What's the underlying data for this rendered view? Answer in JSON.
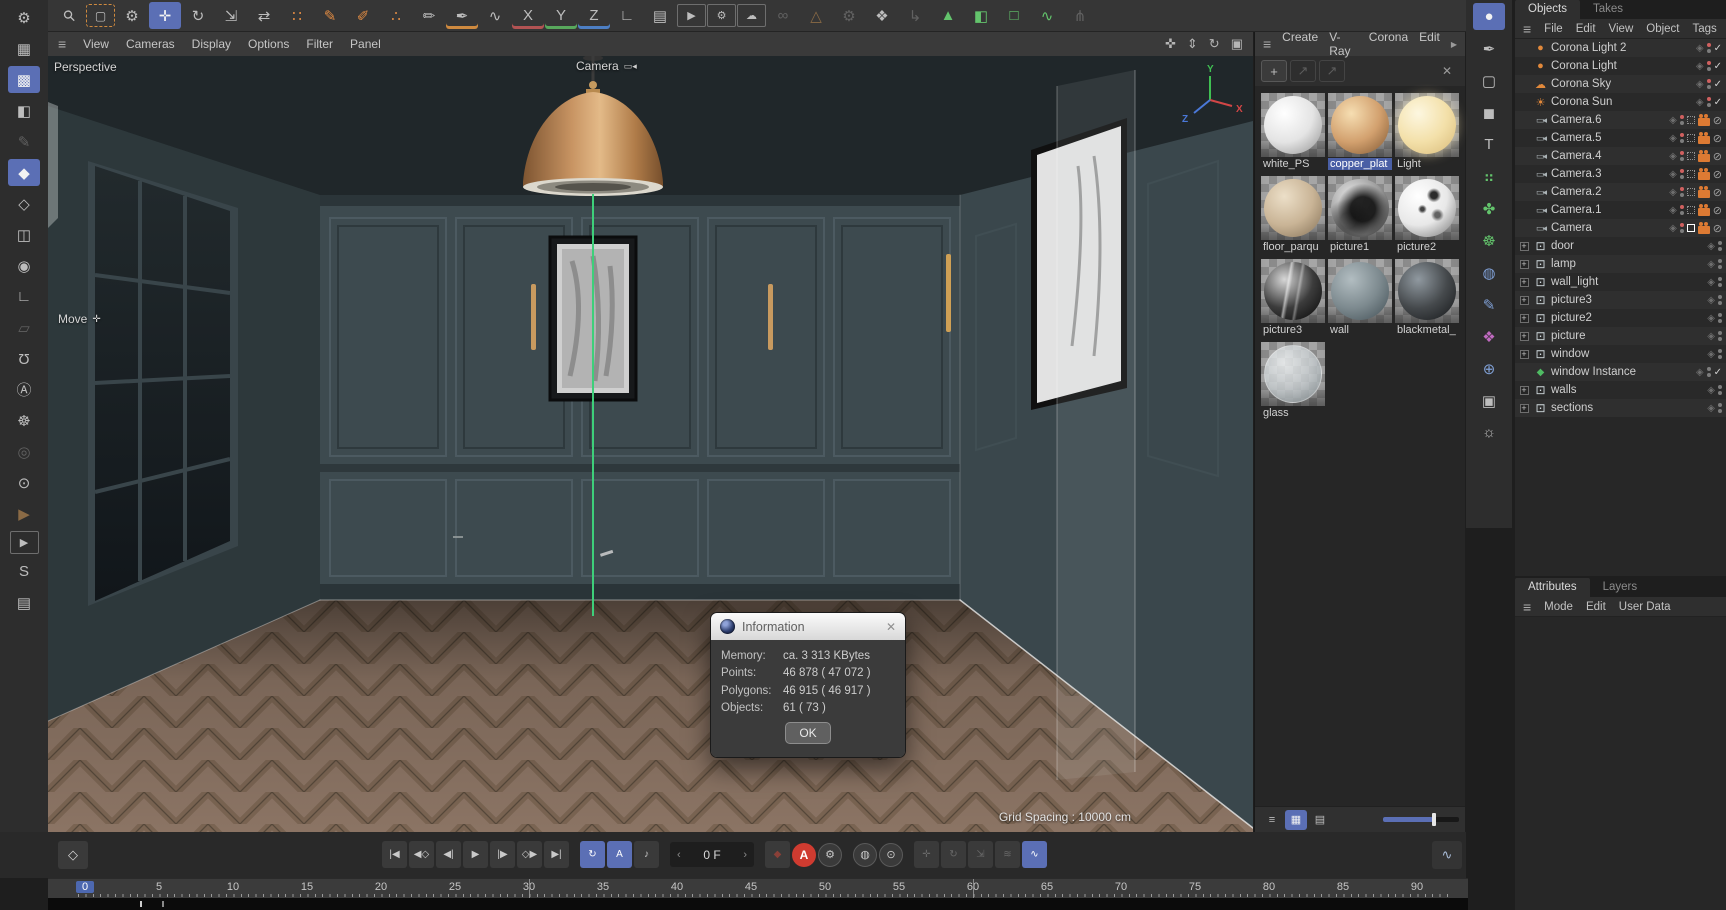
{
  "colors": {
    "accent_blue": "#5b6fb5",
    "accent_orange": "#e08b43",
    "corona_green": "#63c46c",
    "autokey_red": "#cf3b30",
    "playhead_blue": "#4d68b0",
    "material_selected": "#4a5fa5",
    "wall": "#3d4a4f",
    "floor": "#8b7464",
    "gizmo_x": "#d24646",
    "gizmo_y": "#3fbf52",
    "gizmo_z": "#4a78d8"
  },
  "icons": {
    "burger": "≡",
    "close": "✕",
    "check": "✓",
    "prohibit": "⊘",
    "layers": "◈",
    "expand": "+"
  },
  "left_toolbar": {
    "items": [
      {
        "n": "preferences-icon",
        "g": "⚙"
      },
      {
        "n": "workplane-icon",
        "g": "▦"
      },
      {
        "n": "lock-workplane-icon",
        "g": "▩",
        "c": "sel"
      },
      {
        "n": "model-mode-icon",
        "g": "◧"
      },
      {
        "n": "texture-mode-icon",
        "g": "✎",
        "c": "dim"
      },
      {
        "n": "object-mode-icon",
        "g": "◆",
        "c": "sel"
      },
      {
        "n": "polygon-mode-icon",
        "g": "◇"
      },
      {
        "n": "edge-mode-icon",
        "g": "◫"
      },
      {
        "n": "point-mode-icon",
        "g": "◉"
      },
      {
        "n": "axis-mode-icon",
        "g": "∟"
      },
      {
        "n": "workplane-mode-icon",
        "g": "▱",
        "c": "dim"
      },
      {
        "n": "snap-icon",
        "g": "Ω",
        "c": "flip"
      },
      {
        "n": "quantize-icon",
        "g": "Ⓐ"
      },
      {
        "n": "modes-gear-icon",
        "g": "☸"
      },
      {
        "n": "target-icon",
        "g": "◎",
        "c": "dim"
      },
      {
        "n": "solo-icon",
        "g": "⊙"
      },
      {
        "n": "ir-region-icon",
        "g": "▶",
        "c": "dim-orange"
      },
      {
        "n": "interactive-render-icon",
        "g": "▶",
        "c": "boxed"
      },
      {
        "n": "substance-icon",
        "g": "S"
      },
      {
        "n": "asset-browser-icon",
        "g": "▤"
      }
    ]
  },
  "top_toolbar": {
    "items": [
      {
        "n": "search-icon",
        "g": "⚲",
        "c": "rot45"
      },
      {
        "n": "live-selection-icon",
        "g": "▢",
        "c": "orange-dash"
      },
      {
        "n": "tweak-icon",
        "g": "⚙"
      },
      {
        "n": "move-icon",
        "g": "✛",
        "c": "sel"
      },
      {
        "n": "rotate-icon",
        "g": "↻"
      },
      {
        "n": "scale-icon",
        "g": "⇲"
      },
      {
        "n": "transform-tool-icon",
        "g": "⇄"
      },
      {
        "n": "point-transform-icon",
        "g": "∷",
        "c": "orange"
      },
      {
        "n": "spline-pen-icon",
        "g": "✎",
        "c": "orange"
      },
      {
        "n": "polygon-pen-icon",
        "g": "✐",
        "c": "orange"
      },
      {
        "n": "point-weld-icon",
        "g": "∴",
        "c": "orange"
      },
      {
        "n": "brush-icon",
        "g": "✏"
      },
      {
        "n": "pen-tool-icon",
        "g": "✒",
        "c": "u-orange"
      },
      {
        "n": "sculpt-icon",
        "g": "∿"
      },
      {
        "n": "x-axis-icon",
        "g": "X",
        "c": "u-red"
      },
      {
        "n": "y-axis-icon",
        "g": "Y",
        "c": "u-green"
      },
      {
        "n": "z-axis-icon",
        "g": "Z",
        "c": "u-blue"
      },
      {
        "n": "coord-system-icon",
        "g": "∟"
      },
      {
        "n": "render-view-icon",
        "g": "▤"
      },
      {
        "n": "render-picture-viewer-icon",
        "g": "▶",
        "c": "boxed"
      },
      {
        "n": "render-settings-icon",
        "g": "⚙",
        "c": "boxed"
      },
      {
        "n": "render-queue-icon",
        "g": "☁",
        "c": "boxed"
      },
      {
        "n": "link-icon",
        "g": "∞",
        "c": "dim"
      },
      {
        "n": "triangulate-icon",
        "g": "△",
        "c": "dim-orange"
      },
      {
        "n": "gear-icon",
        "g": "⚙",
        "c": "dim"
      },
      {
        "n": "center-axis-icon",
        "g": "❖"
      },
      {
        "n": "axis-transfer-icon",
        "g": "↳",
        "c": "dim"
      },
      {
        "n": "corona-proxy-icon",
        "g": "▲",
        "c": "green"
      },
      {
        "n": "corona-scatter-icon",
        "g": "◧",
        "c": "green"
      },
      {
        "n": "corona-volume-icon",
        "g": "□",
        "c": "green"
      },
      {
        "n": "corona-slicer-icon",
        "g": "∿",
        "c": "green"
      },
      {
        "n": "joint-tool-icon",
        "g": "⋔",
        "c": "dim"
      }
    ]
  },
  "right_strip": {
    "items": [
      {
        "n": "material-ball-icon",
        "g": "●",
        "c": "sel"
      },
      {
        "n": "paint-tool-icon",
        "g": "✒"
      },
      {
        "n": "plane-icon",
        "g": "▢"
      },
      {
        "n": "cube-icon",
        "g": "◼"
      },
      {
        "n": "text-tool-icon",
        "g": "T"
      },
      {
        "n": "cluster-icon",
        "g": "⠶",
        "c": "green"
      },
      {
        "n": "field-icon",
        "g": "✤",
        "c": "green"
      },
      {
        "n": "dynamics-icon",
        "g": "☸",
        "c": "green"
      },
      {
        "n": "sphere-icon",
        "g": "◍",
        "c": "blue"
      },
      {
        "n": "spline-draw-icon",
        "g": "✎",
        "c": "blue"
      },
      {
        "n": "mograph-icon",
        "g": "❖",
        "c": "magenta"
      },
      {
        "n": "globe-icon",
        "g": "⊕",
        "c": "blue"
      },
      {
        "n": "camera-add-icon",
        "g": "▣"
      },
      {
        "n": "light-icon",
        "g": "☼"
      }
    ]
  },
  "viewport": {
    "menu": [
      "View",
      "Cameras",
      "Display",
      "Options",
      "Filter",
      "Panel"
    ],
    "right_icons": [
      {
        "n": "pan-icon",
        "g": "✜"
      },
      {
        "n": "dolly-icon",
        "g": "⇕"
      },
      {
        "n": "orbit-icon",
        "g": "↻"
      },
      {
        "n": "viewport-toggle-icon",
        "g": "▣"
      }
    ],
    "hud": {
      "view_label": "Perspective",
      "camera_label": "Camera",
      "camera_icon": "▭◂",
      "tool_label": "Move",
      "tool_icon": "✛",
      "grid_spacing": "Grid Spacing : 10000 cm"
    }
  },
  "dialog": {
    "title": "Information",
    "rows": [
      {
        "label": "Memory:",
        "value": "ca. 3 313 KBytes"
      },
      {
        "label": "Points:",
        "value": "46 878 ( 47 072 )"
      },
      {
        "label": "Polygons:",
        "value": "46 915 ( 46 917 )"
      },
      {
        "label": "Objects:",
        "value": "61 ( 73 )"
      }
    ],
    "ok_label": "OK"
  },
  "materials": {
    "menu": [
      "Create",
      "V-Ray",
      "Corona",
      "Edit"
    ],
    "overflow_icon": "▶",
    "tools": [
      {
        "n": "add-material-button",
        "g": "+"
      },
      {
        "n": "promote-arrow-icon",
        "g": "↗",
        "c": "dim"
      },
      {
        "n": "promote-arrow2-icon",
        "g": "↗",
        "c": "dim"
      }
    ],
    "delete_icon": "✕",
    "items": [
      {
        "name": "white_PS",
        "hi": "#ffffff",
        "base": "#e4e4e4",
        "lo": "#8f8f8f"
      },
      {
        "name": "copper_plat",
        "hi": "#f6deb2",
        "base": "#d2a06e",
        "lo": "#7d5530",
        "selCls": "sel"
      },
      {
        "name": "Light",
        "hi": "#fdf7e0",
        "base": "#f3e0a9",
        "lo": "#d8ba78",
        "fx": "glow"
      },
      {
        "name": "floor_parqu",
        "hi": "#ecdfc8",
        "base": "#c9b496",
        "lo": "#826f55"
      },
      {
        "name": "picture1",
        "hi": "#e6e6e6",
        "base": "#9b9b9b",
        "lo": "#1f1f1f",
        "fx": "marble"
      },
      {
        "name": "picture2",
        "hi": "#ffffff",
        "base": "#e8e8e8",
        "lo": "#6f6f6f",
        "fx": "splat"
      },
      {
        "name": "picture3",
        "hi": "#d6d6d6",
        "base": "#3c3c3c",
        "lo": "#050505",
        "fx": "streak"
      },
      {
        "name": "wall",
        "hi": "#b2bdc1",
        "base": "#7d8a8f",
        "lo": "#404d53"
      },
      {
        "name": "blackmetal_",
        "hi": "#9099a0",
        "base": "#45494c",
        "lo": "#141618"
      },
      {
        "name": "glass",
        "hi": "#f4f7f8",
        "base": "#c8ced1",
        "lo": "#859094",
        "fx": "glass"
      }
    ],
    "footer_icons": [
      {
        "n": "list-view-icon",
        "g": "≡"
      },
      {
        "n": "grid-view-icon",
        "g": "▦",
        "c": "sel"
      },
      {
        "n": "layer-view-icon",
        "g": "▤"
      }
    ]
  },
  "objects_panel": {
    "tabs": [
      {
        "label": "Objects",
        "c": "sel"
      },
      {
        "label": "Takes"
      }
    ],
    "menu": [
      "File",
      "Edit",
      "View",
      "Object",
      "Tags"
    ],
    "items": [
      {
        "name": "Corona Light 2",
        "g": "●",
        "ic": "orange",
        "dot": "red",
        "check": true
      },
      {
        "name": "Corona Light",
        "g": "●",
        "ic": "orange",
        "dot": "red",
        "check": true
      },
      {
        "name": "Corona Sky",
        "g": "☁",
        "ic": "orange",
        "dot": "red",
        "check": true
      },
      {
        "name": "Corona Sun",
        "g": "☀",
        "ic": "orange",
        "dot": "red",
        "check": true
      },
      {
        "name": "Camera.6",
        "g": "▭◂",
        "ic": "gray",
        "dot": "red",
        "cam": true
      },
      {
        "name": "Camera.5",
        "g": "▭◂",
        "ic": "gray",
        "dot": "red",
        "cam": true
      },
      {
        "name": "Camera.4",
        "g": "▭◂",
        "ic": "gray",
        "dot": "red",
        "cam": true
      },
      {
        "name": "Camera.3",
        "g": "▭◂",
        "ic": "gray",
        "dot": "red",
        "cam": true
      },
      {
        "name": "Camera.2",
        "g": "▭◂",
        "ic": "gray",
        "dot": "red",
        "cam": true
      },
      {
        "name": "Camera.1",
        "g": "▭◂",
        "ic": "gray",
        "dot": "red",
        "cam": true
      },
      {
        "name": "Camera",
        "g": "▭◂",
        "ic": "gray",
        "dot": "red",
        "cam": true,
        "actCls": "act"
      },
      {
        "name": "door",
        "g": "⊡",
        "ic": "null",
        "expCls": "on"
      },
      {
        "name": "lamp",
        "g": "⊡",
        "ic": "null",
        "expCls": "on"
      },
      {
        "name": "wall_light",
        "g": "⊡",
        "ic": "null",
        "expCls": "on"
      },
      {
        "name": "picture3",
        "g": "⊡",
        "ic": "null",
        "expCls": "on"
      },
      {
        "name": "picture2",
        "g": "⊡",
        "ic": "null",
        "expCls": "on"
      },
      {
        "name": "picture",
        "g": "⊡",
        "ic": "null",
        "expCls": "on"
      },
      {
        "name": "window",
        "g": "⊡",
        "ic": "null",
        "expCls": "on"
      },
      {
        "name": "window Instance",
        "g": "◆",
        "ic": "green",
        "check": true
      },
      {
        "name": "walls",
        "g": "⊡",
        "ic": "null",
        "expCls": "on"
      },
      {
        "name": "sections",
        "g": "⊡",
        "ic": "null",
        "expCls": "on"
      }
    ]
  },
  "attributes_panel": {
    "tabs": [
      {
        "label": "Attributes",
        "c": "sel"
      },
      {
        "label": "Layers"
      }
    ],
    "menu": [
      "Mode",
      "Edit",
      "User Data"
    ]
  },
  "timeline": {
    "transport": [
      {
        "n": "goto-start-icon",
        "g": "|◀"
      },
      {
        "n": "prev-key-icon",
        "g": "◀◇"
      },
      {
        "n": "prev-frame-icon",
        "g": "◀|"
      },
      {
        "n": "play-icon",
        "g": "▶"
      },
      {
        "n": "next-frame-icon",
        "g": "|▶"
      },
      {
        "n": "next-key-icon",
        "g": "◇▶"
      },
      {
        "n": "goto-end-icon",
        "g": "▶|"
      }
    ],
    "toggles": [
      {
        "n": "loop-icon",
        "g": "↻",
        "c": "sel"
      },
      {
        "n": "autokey-hud-icon",
        "g": "A",
        "c": "sel"
      },
      {
        "n": "sound-icon",
        "g": "♪"
      }
    ],
    "frame_field": {
      "left": "‹",
      "value": "0 F",
      "right": "›"
    },
    "record": [
      {
        "n": "record-key-icon",
        "g": "◆",
        "c": "dimred"
      },
      {
        "n": "autokey-icon",
        "g": "A",
        "c": "redcircle"
      },
      {
        "n": "keying-settings-icon",
        "g": "⚙",
        "c": "circle"
      }
    ],
    "key_modes": [
      {
        "n": "position-key-icon",
        "g": "◍",
        "c": "circle"
      },
      {
        "n": "rotation-key-icon",
        "g": "⊙",
        "c": "circle"
      }
    ],
    "record_toggles": [
      {
        "n": "record-position-icon",
        "g": "✛",
        "c": "dim"
      },
      {
        "n": "record-rotation-icon",
        "g": "↻",
        "c": "dim"
      },
      {
        "n": "record-scale-icon",
        "g": "⇲",
        "c": "dim"
      },
      {
        "n": "record-parameter-icon",
        "g": "≋",
        "c": "dim"
      },
      {
        "n": "record-pla-icon",
        "g": "∿",
        "c": "sel"
      }
    ],
    "keyframe_button": "◇",
    "fcurve_button": "∿",
    "ticks": [
      {
        "v": "0",
        "c": "playhead"
      },
      {
        "v": "5"
      },
      {
        "v": "10"
      },
      {
        "v": "15"
      },
      {
        "v": "20"
      },
      {
        "v": "25"
      },
      {
        "v": "30",
        "c": "mark"
      },
      {
        "v": "35"
      },
      {
        "v": "40"
      },
      {
        "v": "45"
      },
      {
        "v": "50"
      },
      {
        "v": "55"
      },
      {
        "v": "60",
        "c": "mark"
      },
      {
        "v": "65"
      },
      {
        "v": "70"
      },
      {
        "v": "75"
      },
      {
        "v": "80"
      },
      {
        "v": "85"
      },
      {
        "v": "90"
      }
    ]
  }
}
